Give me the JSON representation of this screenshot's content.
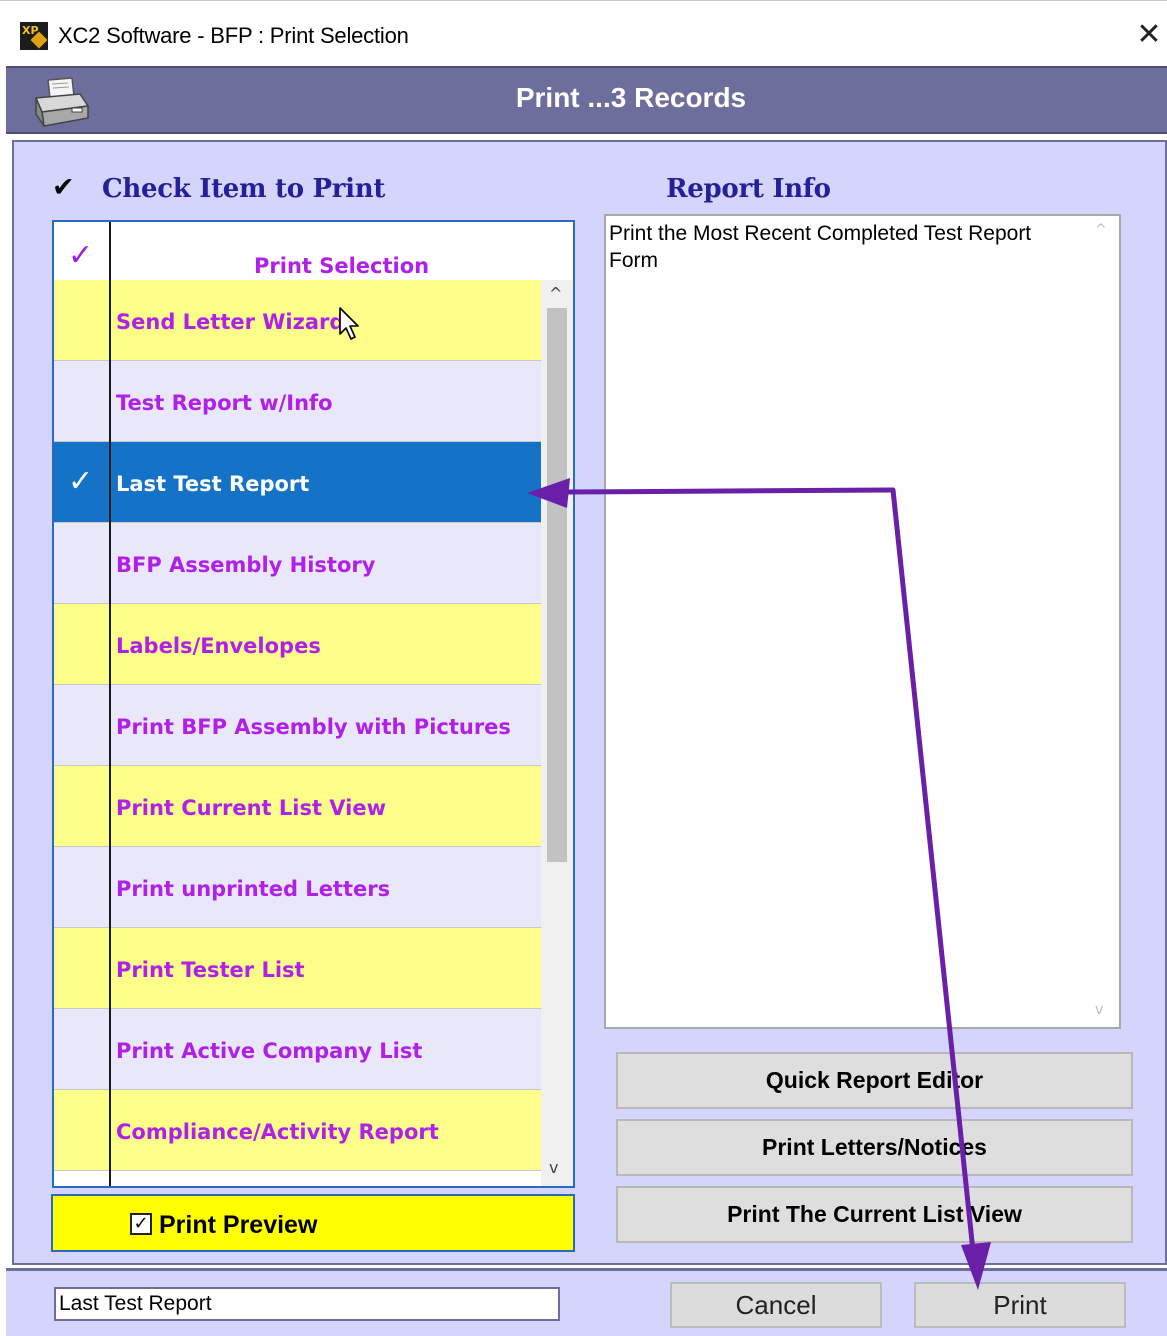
{
  "window": {
    "title": "XC2 Software - BFP : Print Selection",
    "close_label": "✕",
    "icon": "xc2-app-icon"
  },
  "header": {
    "title": "Print ...3 Records",
    "icon": "printer-icon"
  },
  "left_panel": {
    "heading_check": "✔",
    "heading": "Check Item to Print",
    "column_header": "Print Selection",
    "column_header_check": "✓",
    "items": [
      {
        "label": "Send Letter Wizard",
        "checked": false,
        "selected": false
      },
      {
        "label": "Test Report w/Info",
        "checked": false,
        "selected": false
      },
      {
        "label": "Last Test Report",
        "checked": true,
        "selected": true
      },
      {
        "label": "BFP Assembly History",
        "checked": false,
        "selected": false
      },
      {
        "label": "Labels/Envelopes",
        "checked": false,
        "selected": false
      },
      {
        "label": "Print BFP Assembly with Pictures",
        "checked": false,
        "selected": false
      },
      {
        "label": "Print Current List View",
        "checked": false,
        "selected": false
      },
      {
        "label": "Print unprinted Letters",
        "checked": false,
        "selected": false
      },
      {
        "label": "Print Tester List",
        "checked": false,
        "selected": false
      },
      {
        "label": "Print Active Company List",
        "checked": false,
        "selected": false
      },
      {
        "label": "Compliance/Activity  Report",
        "checked": false,
        "selected": false
      }
    ],
    "item_check": "✓",
    "print_preview": {
      "label": "Print Preview",
      "checked": true,
      "check_glyph": "✓"
    }
  },
  "right_panel": {
    "heading": "Report Info",
    "report_text": "Print the Most Recent Completed Test Report Form",
    "buttons": [
      {
        "label": "Quick Report Editor"
      },
      {
        "label": "Print Letters/Notices"
      },
      {
        "label": "Print The Current List View"
      }
    ]
  },
  "footer": {
    "status_value": "Last Test Report",
    "cancel_label": "Cancel",
    "print_label": "Print"
  },
  "scroll": {
    "up_glyph": "^",
    "down_glyph": "v"
  },
  "colors": {
    "accent_purple": "#b020e8",
    "heading_blue": "#24209a",
    "header_band": "#6e6e9c",
    "selected_row": "#1473c6",
    "row_yellow": "#fdfd8a",
    "row_lavender": "#e8e8fa",
    "annotation_arrow": "#6a1fa8"
  }
}
